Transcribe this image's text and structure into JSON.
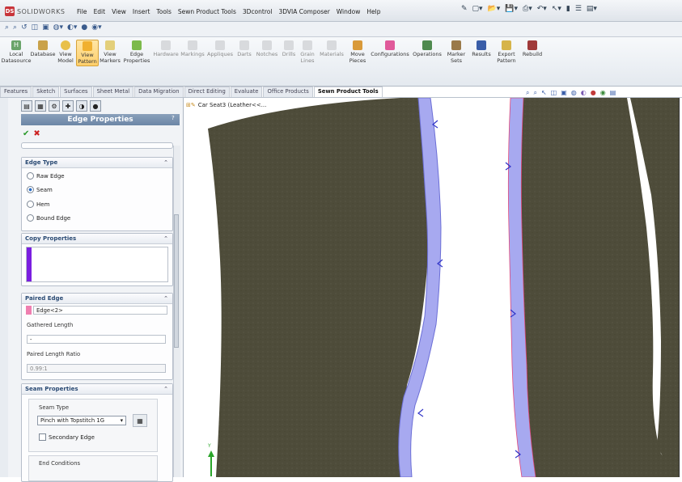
{
  "app": {
    "logo_text": "SOLIDWORKS"
  },
  "menu": [
    "File",
    "Edit",
    "View",
    "Insert",
    "Tools",
    "Sewn Product Tools",
    "3Dcontrol",
    "3DVIA Composer",
    "Window",
    "Help"
  ],
  "command_manager": [
    {
      "label": "Local Datasource",
      "icon": "datasource-icon"
    },
    {
      "label": "Database",
      "icon": "database-icon"
    },
    {
      "label": "View Model",
      "icon": "view-model-icon"
    },
    {
      "label": "View Pattern",
      "icon": "view-pattern-icon",
      "active": true
    },
    {
      "label": "View Markers",
      "icon": "view-markers-icon"
    },
    {
      "label": "Edge Properties",
      "icon": "edge-properties-icon"
    },
    {
      "label": "Hardware",
      "icon": "hardware-icon"
    },
    {
      "label": "Markings",
      "icon": "markings-icon"
    },
    {
      "label": "Appliques",
      "icon": "appliques-icon"
    },
    {
      "label": "Darts",
      "icon": "darts-icon"
    },
    {
      "label": "Notches",
      "icon": "notches-icon"
    },
    {
      "label": "Drills",
      "icon": "drills-icon"
    },
    {
      "label": "Grain Lines",
      "icon": "grain-lines-icon"
    },
    {
      "label": "Materials",
      "icon": "materials-icon"
    },
    {
      "label": "Move Pieces",
      "icon": "move-pieces-icon"
    },
    {
      "label": "Configurations",
      "icon": "configurations-icon"
    },
    {
      "label": "Operations",
      "icon": "operations-icon"
    },
    {
      "label": "Marker Sets",
      "icon": "marker-sets-icon"
    },
    {
      "label": "Results",
      "icon": "results-icon"
    },
    {
      "label": "Export Pattern",
      "icon": "export-pattern-icon"
    },
    {
      "label": "Rebuild",
      "icon": "rebuild-icon"
    }
  ],
  "tabs": [
    "Features",
    "Sketch",
    "Surfaces",
    "Sheet Metal",
    "Data Migration",
    "Direct Editing",
    "Evaluate",
    "Office Products",
    "Sewn Product Tools"
  ],
  "active_tab": "Sewn Product Tools",
  "property_manager": {
    "title": "Edge Properties",
    "help": "?",
    "edge_type": {
      "heading": "Edge Type",
      "options": [
        "Raw Edge",
        "Seam",
        "Hem",
        "Bound Edge"
      ],
      "selected": "Seam"
    },
    "copy_properties": {
      "heading": "Copy Properties"
    },
    "paired_edge": {
      "heading": "Paired Edge",
      "edge_value": "Edge<2>",
      "gathered_length_label": "Gathered Length",
      "gathered_length_value": "-",
      "paired_ratio_label": "Paired Length Ratio",
      "paired_ratio_value": "0.99:1"
    },
    "seam_properties": {
      "heading": "Seam Properties",
      "seam_type_label": "Seam Type",
      "seam_type_value": "Pinch with Topstitch 1G",
      "secondary_edge_label": "Secondary Edge",
      "end_conditions_label": "End Conditions"
    }
  },
  "viewport": {
    "tree_item": "Car Seat3  (Leather<<..."
  },
  "colors": {
    "fabric": "#4e4c3a",
    "seam_band": "#a7a9f0",
    "seam_edge": "#e0487a",
    "accent": "#2f6fc5"
  }
}
